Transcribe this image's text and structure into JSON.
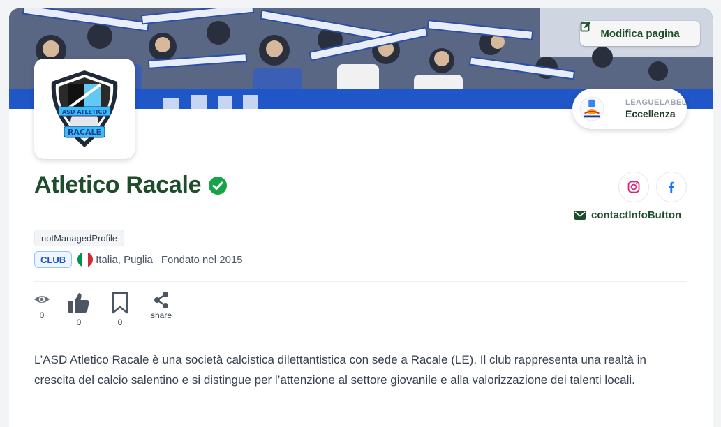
{
  "header": {
    "edit_button_label": "Modifica pagina",
    "league_label": "LEAGUELABEL",
    "league_name": "Eccellenza"
  },
  "club": {
    "name": "Atletico Racale",
    "logo_text_top": "ASD ATLETICO",
    "logo_text_bottom": "RACALE",
    "managed_tag": "notManagedProfile",
    "type_badge": "CLUB",
    "location": "Italia, Puglia",
    "founded": "Fondato nel 2015",
    "contact_label": "contactInfoButton"
  },
  "stats": {
    "views": "0",
    "likes": "0",
    "saves": "0",
    "share_label": "share"
  },
  "description": "L’ASD Atletico Racale è una società calcistica dilettantistica con sede a Racale (LE). Il club rappresenta una realtà in crescita del calcio salentino e si distingue per l’attenzione al settore giovanile e alla valorizzazione dei talenti locali.",
  "colors": {
    "brand_green": "#1e4d2b",
    "verified_green": "#16a34a",
    "instagram": "#d6287a",
    "facebook": "#1877f2",
    "club_badge_blue": "#1d4ed8"
  },
  "icons": {
    "edit": "edit-icon",
    "verified": "check-circle-icon",
    "instagram": "instagram-icon",
    "facebook": "facebook-icon",
    "contact": "envelope-icon",
    "views": "eye-icon",
    "likes": "thumbs-up-icon",
    "saves": "bookmark-icon",
    "share": "share-icon"
  }
}
